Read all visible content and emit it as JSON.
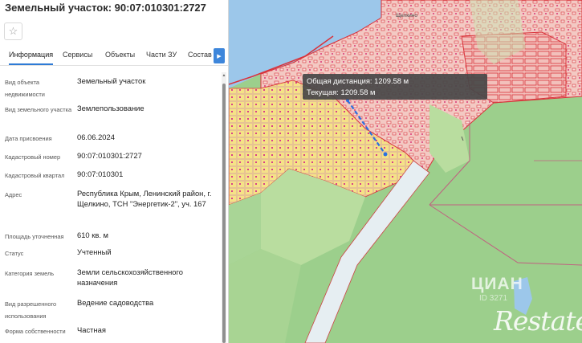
{
  "panel": {
    "title": "Земельный участок: 90:07:010301:2727",
    "favorite_glyph": "☆",
    "tabs": [
      {
        "label": "Информация",
        "active": true
      },
      {
        "label": "Сервисы",
        "active": false
      },
      {
        "label": "Объекты",
        "active": false
      },
      {
        "label": "Части ЗУ",
        "active": false
      },
      {
        "label": "Состав",
        "active": false
      }
    ],
    "tabs_next_glyph": "▶",
    "scroll_up_glyph": "▲",
    "rows": [
      {
        "label": "Вид объекта недвижимости",
        "value": "Земельный участок"
      },
      {
        "label": "Вид земельного участка",
        "value": "Землепользование"
      },
      {
        "label": "Дата присвоения",
        "value": "06.06.2024"
      },
      {
        "label": "Кадастровый номер",
        "value": "90:07:010301:2727"
      },
      {
        "label": "Кадастровый квартал",
        "value": "90:07:010301"
      },
      {
        "label": "Адрес",
        "value": "Республика Крым, Ленинский район, г. Щелкино, ТСН \"Энергетик-2\", уч. 167"
      },
      {
        "label": "Площадь уточненная",
        "value": "610 кв. м"
      },
      {
        "label": "Статус",
        "value": "Учтенный"
      },
      {
        "label": "Категория земель",
        "value": "Земли сельскохозяйственного назначения"
      },
      {
        "label": "Вид разрешенного использования",
        "value": "Ведение садоводства"
      },
      {
        "label": "Форма собственности",
        "value": "Частная"
      }
    ]
  },
  "map": {
    "tooltip": {
      "total": "Общая дистанция: 1209.58 м",
      "current": "Текущая: 1209.58 м"
    },
    "place_label": "Щелкино",
    "watermarks": {
      "cian": "ЦИАН",
      "cian_id": "ID 3271",
      "restate": "Restate"
    },
    "colors": {
      "water": "#9cc7ea",
      "green": "#9ccf8c",
      "light_green": "#b9dd9f",
      "built": "#f2c4c0",
      "dacha": "#f5e287",
      "boundary": "#d9323a",
      "measure": "#2b6fe0"
    }
  }
}
